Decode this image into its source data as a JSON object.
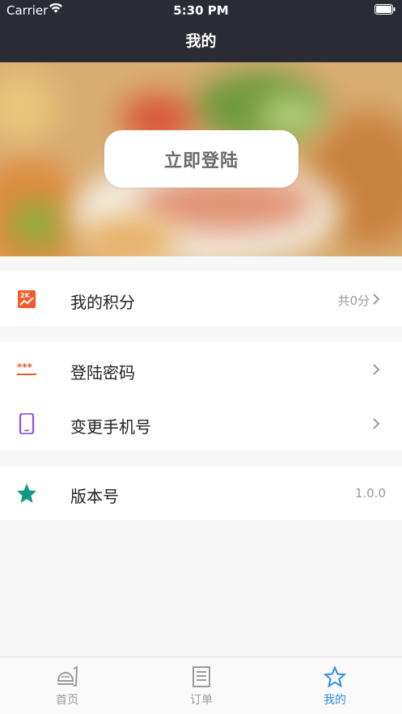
{
  "status_bar": {
    "carrier": "Carrier",
    "time": "5:30 PM"
  },
  "nav": {
    "title": "我的"
  },
  "banner": {
    "login_label": "立即登陆"
  },
  "points_section": {
    "label": "我的积分",
    "value": "共0分",
    "icon": "points-icon",
    "accent": "#f15a2b"
  },
  "account_section": {
    "items": [
      {
        "label": "登陆密码",
        "icon": "password-icon",
        "accent": "#f15a2b"
      },
      {
        "label": "变更手机号",
        "icon": "phone-icon",
        "accent": "#8a4ff0"
      }
    ]
  },
  "about_section": {
    "label": "版本号",
    "value": "1.0.0",
    "icon": "star-icon",
    "accent": "#109a83"
  },
  "tabbar": {
    "active_color": "#2d8ee6",
    "tabs": [
      {
        "label": "首页",
        "icon": "home-food-icon",
        "active": false
      },
      {
        "label": "订单",
        "icon": "order-list-icon",
        "active": false
      },
      {
        "label": "我的",
        "icon": "star-outline-icon",
        "active": true
      }
    ]
  }
}
